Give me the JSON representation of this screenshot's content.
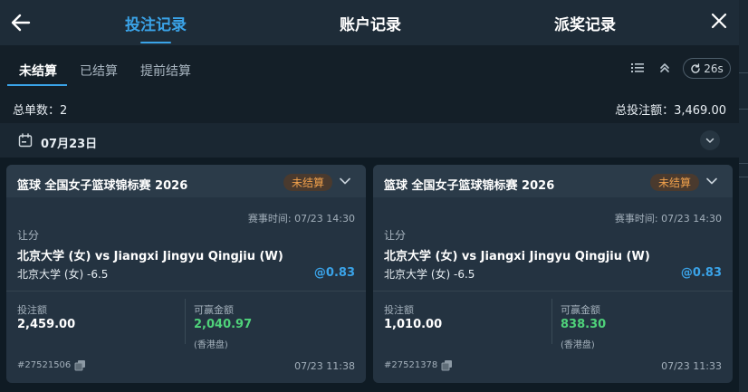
{
  "header": {
    "tabs": [
      {
        "label": "投注记录",
        "active": true
      },
      {
        "label": "账户记录",
        "active": false
      },
      {
        "label": "派奖记录",
        "active": false
      }
    ]
  },
  "subtabs": [
    {
      "label": "未结算",
      "active": true
    },
    {
      "label": "已结算",
      "active": false
    },
    {
      "label": "提前结算",
      "active": false
    }
  ],
  "toolbar": {
    "refresh_label": "26s"
  },
  "summary": {
    "count_text": "总单数：2",
    "total_text": "总投注额：3,469.00"
  },
  "date_group": {
    "label": "07月23日"
  },
  "labels": {
    "stake": "投注额",
    "potential_win": "可赢金额",
    "odds_type": "(香港盘)"
  },
  "bets": [
    {
      "title": "篮球 全国女子篮球锦标赛 2026",
      "status": "未结算",
      "event_time": "赛事时间: 07/23 14:30",
      "market": "让分",
      "match": "北京大学 (女) vs Jiangxi Jingyu Qingjiu (W)",
      "selection": "北京大学 (女) -6.5",
      "odds": "@0.83",
      "stake": "2,459.00",
      "potential_win": "2,040.97",
      "bet_id": "#27521506",
      "placed_time": "07/23 11:38"
    },
    {
      "title": "篮球 全国女子篮球锦标赛 2026",
      "status": "未结算",
      "event_time": "赛事时间: 07/23 14:30",
      "market": "让分",
      "match": "北京大学 (女) vs Jiangxi Jingyu Qingjiu (W)",
      "selection": "北京大学 (女) -6.5",
      "odds": "@0.83",
      "stake": "1,010.00",
      "potential_win": "838.30",
      "bet_id": "#27521378",
      "placed_time": "07/23 11:33"
    }
  ],
  "colors": {
    "accent": "#3aa3e8",
    "win": "#4fd27a",
    "pending": "#f0a04b",
    "background": "#0f1b24"
  }
}
